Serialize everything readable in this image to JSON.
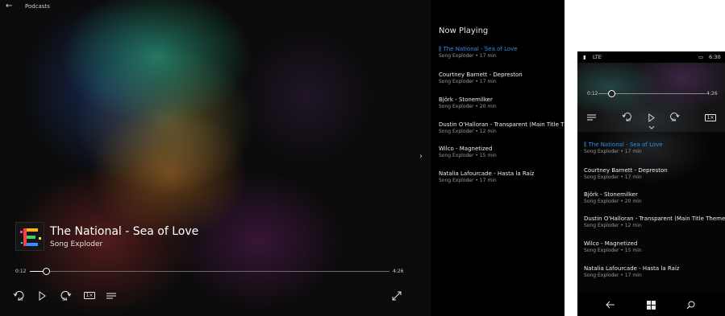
{
  "desktop": {
    "app_title": "Podcasts",
    "back_icon": "back-arrow-icon",
    "window_controls": {
      "minimize": "—",
      "maximize": "☐",
      "close": "✕"
    },
    "now_playing": {
      "title": "The National - Sea of Love",
      "artist": "Song Exploder",
      "elapsed": "0:12",
      "duration": "4:26",
      "progress_fraction": 0.045
    },
    "controls": {
      "skip_back_label": "10",
      "skip_forward_label": "30",
      "rate_label": "1×"
    }
  },
  "panel": {
    "heading": "Now Playing",
    "items": [
      {
        "title": "The National - Sea of Love",
        "meta": "Song Exploder • 17 min",
        "active": true
      },
      {
        "title": "Courtney Barnett - Depreston",
        "meta": "Song Exploder • 17 min"
      },
      {
        "title": "Björk - Stonemilker",
        "meta": "Song Exploder • 20 min"
      },
      {
        "title": "Dustin O'Halloran - Transparent (Main Title The",
        "meta": "Song Exploder • 12 min"
      },
      {
        "title": "Wilco - Magnetized",
        "meta": "Song Exploder • 15 min"
      },
      {
        "title": "Natalia Lafourcade - Hasta la Raíz",
        "meta": "Song Exploder • 17 min"
      }
    ]
  },
  "phone": {
    "network": "LTE",
    "clock": "6:30",
    "elapsed": "0:12",
    "remaining": "-4:26",
    "skip_back_label": "10",
    "skip_forward_label": "30",
    "rate_label": "1×",
    "progress_fraction": 0.12,
    "items": [
      {
        "title": "The National - Sea of Love",
        "meta": "Song Exploder • 17 min",
        "active": true
      },
      {
        "title": "Courtney Barnett - Depreston",
        "meta": "Song Exploder • 17 min"
      },
      {
        "title": "Björk - Stonemilker",
        "meta": "Song Exploder • 20 min"
      },
      {
        "title": "Dustin O'Halloran - Transparent (Main Title Theme)",
        "meta": "Song Exploder • 12 min"
      },
      {
        "title": "Wilco - Magnetized",
        "meta": "Song Exploder • 15 min"
      },
      {
        "title": "Natalia Lafourcade - Hasta la Raíz",
        "meta": "Song Exploder • 17 min"
      }
    ]
  },
  "colors": {
    "accent": "#2f8fe6",
    "background": "#0b0b0b",
    "panel_background": "#000000"
  }
}
